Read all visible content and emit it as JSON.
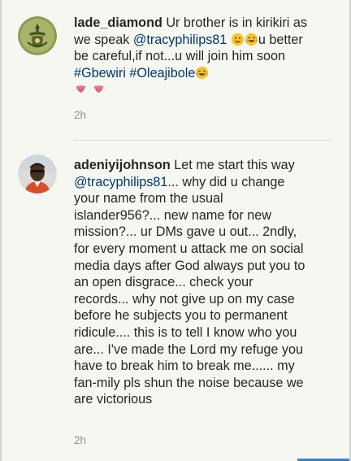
{
  "comments": [
    {
      "username": "lade_diamond",
      "text_1": "Ur brother is in kirikiri as we speak",
      "mention": "@tracyphilips81",
      "text_2": "u better be careful,if not...u will join him soon",
      "hashtag_1": "#Gbewiri",
      "hashtag_2": "#Oleajibole",
      "time": "2h",
      "avatar_icon": "profile-photo-icon"
    },
    {
      "username": "adeniyijohnson",
      "text_1": "Let me start this way",
      "mention": "@tracyphilips81",
      "text_2": "... why did u change your name from the usual islander956?... new name for new mission?... ur DMs gave u out... 2ndly, for every moment u attack me on social media days after God always put you to an open disgrace... check your records... why not give up on my case before he subjects you to permanent ridicule.... this is to tell I know who you are... I've made the Lord my refuge you have to break him to break me...... my fan-mily pls shun the noise because we are victorious",
      "time": "2h",
      "avatar_icon": "profile-photo-icon"
    }
  ],
  "colors": {
    "background": "#f7f7f2",
    "text": "#262626",
    "link": "#00376b",
    "muted": "#8e8e8e",
    "divider": "#dbdbdb"
  }
}
